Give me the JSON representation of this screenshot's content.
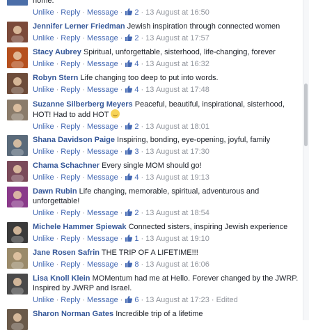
{
  "actions": {
    "unlike": "Unlike",
    "reply": "Reply",
    "message": "Message",
    "sep": "·"
  },
  "top_fragment": {
    "text": "home.",
    "likes": "2",
    "time": "13 August at 16:50"
  },
  "comments": [
    {
      "name": "Jennifer Lerner Friedman",
      "text": "Jewish inspiration through connected women",
      "likes": "2",
      "time": "13 August at 17:57",
      "avatar_color": "#7b4a3a"
    },
    {
      "name": "Stacy Aubrey",
      "text": "Spiritual, unforgettable, sisterhood, life-changing, forever",
      "likes": "4",
      "time": "13 August at 16:32",
      "avatar_color": "#b5501e"
    },
    {
      "name": "Robyn Stern",
      "text": "Life changing too deep to put into words.",
      "likes": "4",
      "time": "13 August at 17:48",
      "avatar_color": "#6d4c3a"
    },
    {
      "name": "Suzanne Silberberg Meyers",
      "text": "Peaceful, beautiful, inspirational, sisterhood, HOT! Had to add HOT",
      "emoji": "smile-emoji",
      "likes": "2",
      "time": "13 August at 18:01",
      "avatar_color": "#8a7b6a"
    },
    {
      "name": "Shana Davidson Paige",
      "text": "Inspiring, bonding, eye-opening, joyful, family",
      "likes": "3",
      "time": "13 August at 17:30",
      "avatar_color": "#5a6a7a"
    },
    {
      "name": "Chama Schachner",
      "text": "Every single MOM should go!",
      "likes": "4",
      "time": "13 August at 19:13",
      "avatar_color": "#7a4a5a"
    },
    {
      "name": "Dawn Rubin",
      "text": "Life changing, memorable, spiritual, adventurous and unforgettable!",
      "likes": "2",
      "time": "13 August at 18:54",
      "avatar_color": "#8a3a8a"
    },
    {
      "name": "Michele Hammer Spiewak",
      "text": "Connected sisters, inspiring Jewish experience",
      "likes": "1",
      "time": "13 August at 19:10",
      "avatar_color": "#3a3a3a"
    },
    {
      "name": "Jane Rosen Safrin",
      "text": "THE TRIP OF A LIFETIME!!!",
      "likes": "8",
      "time": "13 August at 16:06",
      "avatar_color": "#9a8a6a"
    },
    {
      "name": "Lisa Knoll Klein",
      "text": "MOMentum had me at Hello. Forever changed by the JWRP. Inspired by JWRP and Israel.",
      "likes": "6",
      "time": "13 August at 17:23",
      "edited": "Edited",
      "avatar_color": "#4a4a4a"
    },
    {
      "name": "Sharon Norman Gates",
      "text": "Incredible trip of a lifetime",
      "avatar_color": "#6a5a4a"
    }
  ]
}
